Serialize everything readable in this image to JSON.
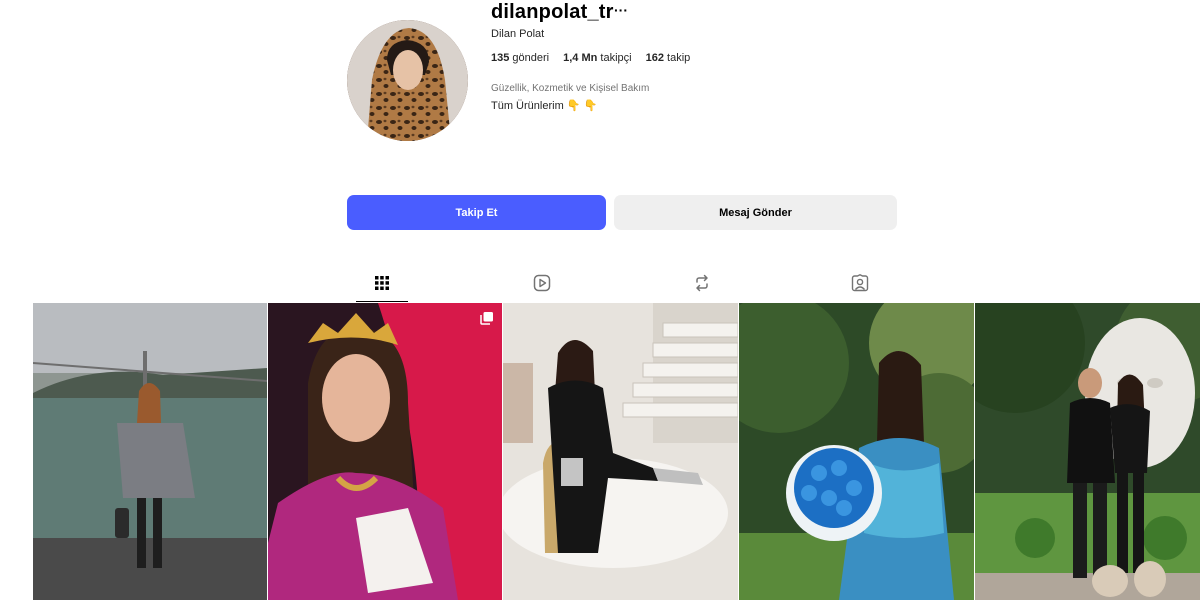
{
  "profile": {
    "username": "dilanpolat_tr",
    "full_name": "Dilan Polat",
    "stats": {
      "posts_count": "135",
      "posts_label": "gönderi",
      "followers_count": "1,4 Mn",
      "followers_label": "takipçi",
      "following_count": "162",
      "following_label": "takip"
    },
    "category": "Güzellik, Kozmetik ve Kişisel Bakım",
    "bio": "Tüm Ürünlerim 👇 👇"
  },
  "actions": {
    "follow_label": "Takip Et",
    "message_label": "Mesaj Gönder"
  },
  "tabs": [
    {
      "icon": "grid-icon",
      "active": true
    },
    {
      "icon": "reels-icon",
      "active": false
    },
    {
      "icon": "repost-icon",
      "active": false
    },
    {
      "icon": "tagged-icon",
      "active": false
    }
  ],
  "posts": [
    {
      "description": "woman-by-bosphorus-bridge"
    },
    {
      "description": "woman-with-crown-pink-dress",
      "multi": true
    },
    {
      "description": "woman-in-black-dress-on-chair"
    },
    {
      "description": "woman-with-blue-roses-bouquet"
    },
    {
      "description": "couple-in-garden"
    }
  ],
  "colors": {
    "accent": "#4a5dff",
    "secondary_button": "#efefef",
    "muted_text": "#737373"
  }
}
